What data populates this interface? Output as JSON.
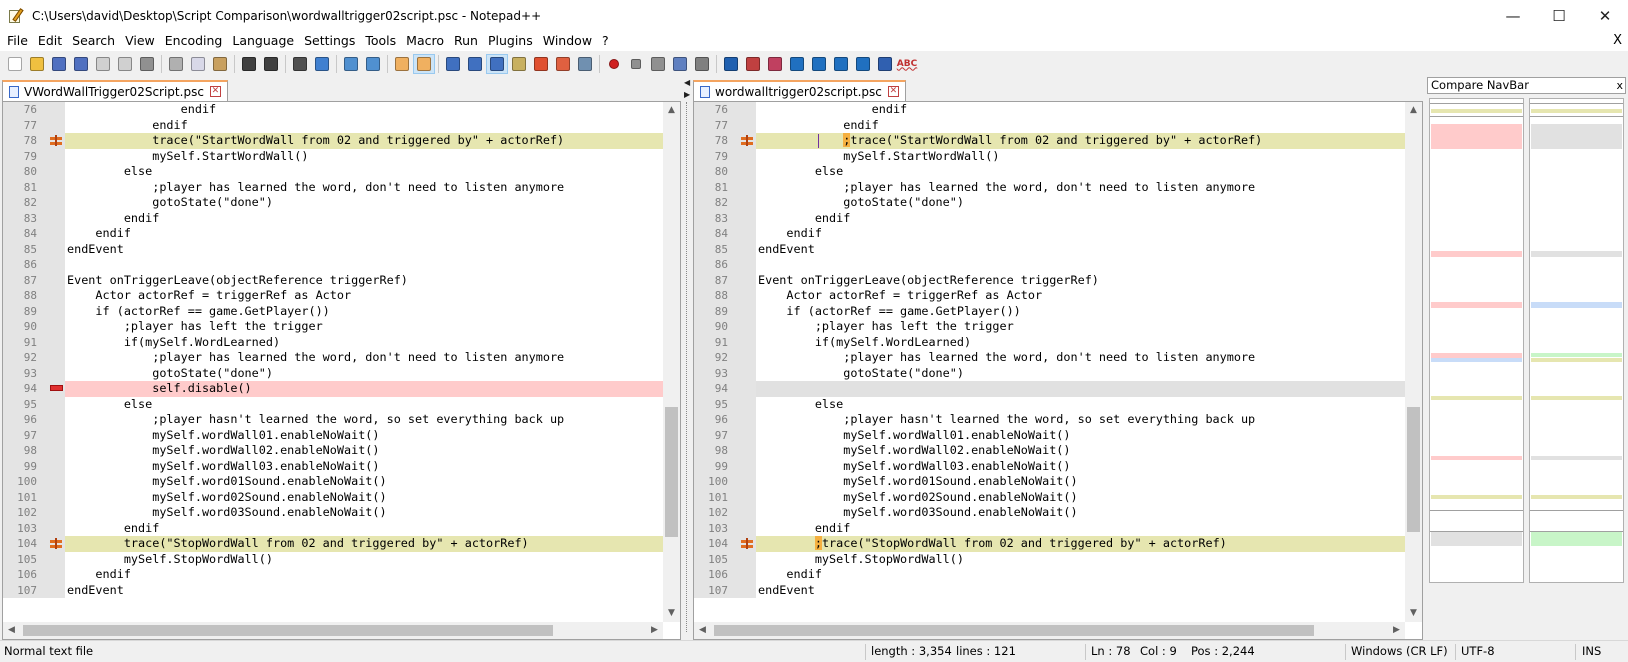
{
  "window": {
    "title": "C:\\Users\\david\\Desktop\\Script Comparison\\wordwalltrigger02script.psc - Notepad++",
    "minimize": "—",
    "maximize": "☐",
    "close": "✕"
  },
  "menu": {
    "items": [
      "File",
      "Edit",
      "Search",
      "View",
      "Encoding",
      "Language",
      "Settings",
      "Tools",
      "Macro",
      "Run",
      "Plugins",
      "Window",
      "?"
    ],
    "close_doc": "X"
  },
  "toolbar": {
    "icons": [
      "new-file-icon",
      "open-file-icon",
      "save-icon",
      "save-all-icon",
      "close-icon",
      "close-all-icon",
      "print-icon",
      "|",
      "cut-icon",
      "copy-icon",
      "paste-icon",
      "|",
      "undo-icon",
      "redo-icon",
      "|",
      "find-icon",
      "replace-icon",
      "|",
      "zoom-in-icon",
      "zoom-out-icon",
      "|",
      "sync-vertical-icon",
      "sync-horizontal-icon",
      "|",
      "word-wrap-icon",
      "show-all-chars-icon",
      "indent-guide-icon",
      "doc-map-icon",
      "function-list-icon",
      "folder-workspace-icon",
      "monitor-icon",
      "|",
      "record-macro-icon",
      "stop-macro-icon",
      "play-macro-icon",
      "run-macro-multiple-icon",
      "save-macro-icon",
      "|",
      "compare-icon",
      "clear-compare-icon",
      "navigation-icon",
      "first-diff-icon",
      "prev-diff-icon",
      "next-diff-icon",
      "last-diff-icon",
      "compare-panel-icon",
      "spellcheck-icon"
    ],
    "spellcheck_label": "ABC"
  },
  "left_pane": {
    "tab_label": "VWordWallTrigger02Script.psc",
    "lines": [
      {
        "n": "76",
        "text": "                endif",
        "state": "normal"
      },
      {
        "n": "77",
        "text": "            endif",
        "state": "normal"
      },
      {
        "n": "78",
        "text": "            trace(\"StartWordWall from 02 and triggered by\" + actorRef)",
        "state": "changed"
      },
      {
        "n": "79",
        "text": "            mySelf.StartWordWall()",
        "state": "normal"
      },
      {
        "n": "80",
        "text": "        else",
        "state": "normal"
      },
      {
        "n": "81",
        "text": "            ;player has learned the word, don't need to listen anymore",
        "state": "normal"
      },
      {
        "n": "82",
        "text": "            gotoState(\"done\")",
        "state": "normal"
      },
      {
        "n": "83",
        "text": "        endif",
        "state": "normal"
      },
      {
        "n": "84",
        "text": "    endif",
        "state": "normal"
      },
      {
        "n": "85",
        "text": "endEvent",
        "state": "normal"
      },
      {
        "n": "86",
        "text": "",
        "state": "normal"
      },
      {
        "n": "87",
        "text": "Event onTriggerLeave(objectReference triggerRef)",
        "state": "normal"
      },
      {
        "n": "88",
        "text": "    Actor actorRef = triggerRef as Actor",
        "state": "normal"
      },
      {
        "n": "89",
        "text": "    if (actorRef == game.GetPlayer())",
        "state": "normal"
      },
      {
        "n": "90",
        "text": "        ;player has left the trigger",
        "state": "normal"
      },
      {
        "n": "91",
        "text": "        if(mySelf.WordLearned)",
        "state": "normal"
      },
      {
        "n": "92",
        "text": "            ;player has learned the word, don't need to listen anymore",
        "state": "normal"
      },
      {
        "n": "93",
        "text": "            gotoState(\"done\")",
        "state": "normal"
      },
      {
        "n": "94",
        "text": "            self.disable()",
        "state": "removed"
      },
      {
        "n": "95",
        "text": "        else",
        "state": "normal"
      },
      {
        "n": "96",
        "text": "            ;player hasn't learned the word, so set everything back up",
        "state": "normal"
      },
      {
        "n": "97",
        "text": "            mySelf.wordWall01.enableNoWait()",
        "state": "normal"
      },
      {
        "n": "98",
        "text": "            mySelf.wordWall02.enableNoWait()",
        "state": "normal"
      },
      {
        "n": "99",
        "text": "            mySelf.wordWall03.enableNoWait()",
        "state": "normal"
      },
      {
        "n": "100",
        "text": "            mySelf.word01Sound.enableNoWait()",
        "state": "normal"
      },
      {
        "n": "101",
        "text": "            mySelf.word02Sound.enableNoWait()",
        "state": "normal"
      },
      {
        "n": "102",
        "text": "            mySelf.word03Sound.enableNoWait()",
        "state": "normal"
      },
      {
        "n": "103",
        "text": "        endif",
        "state": "normal"
      },
      {
        "n": "104",
        "text": "        trace(\"StopWordWall from 02 and triggered by\" + actorRef)",
        "state": "changed"
      },
      {
        "n": "105",
        "text": "        mySelf.StopWordWall()",
        "state": "normal"
      },
      {
        "n": "106",
        "text": "    endif",
        "state": "normal"
      },
      {
        "n": "107",
        "text": "endEvent",
        "state": "normal"
      }
    ]
  },
  "right_pane": {
    "tab_label": "wordwalltrigger02script.psc",
    "lines": [
      {
        "n": "76",
        "text": "                endif",
        "state": "normal"
      },
      {
        "n": "77",
        "text": "            endif",
        "state": "normal"
      },
      {
        "n": "78",
        "pre": "            ",
        "hl": ";",
        "text": "trace(\"StartWordWall from 02 and triggered by\" + actorRef)",
        "state": "changed"
      },
      {
        "n": "79",
        "text": "            mySelf.StartWordWall()",
        "state": "normal"
      },
      {
        "n": "80",
        "text": "        else",
        "state": "normal"
      },
      {
        "n": "81",
        "text": "            ;player has learned the word, don't need to listen anymore",
        "state": "normal"
      },
      {
        "n": "82",
        "text": "            gotoState(\"done\")",
        "state": "normal"
      },
      {
        "n": "83",
        "text": "        endif",
        "state": "normal"
      },
      {
        "n": "84",
        "text": "    endif",
        "state": "normal"
      },
      {
        "n": "85",
        "text": "endEvent",
        "state": "normal"
      },
      {
        "n": "86",
        "text": "",
        "state": "normal"
      },
      {
        "n": "87",
        "text": "Event onTriggerLeave(objectReference triggerRef)",
        "state": "normal"
      },
      {
        "n": "88",
        "text": "    Actor actorRef = triggerRef as Actor",
        "state": "normal"
      },
      {
        "n": "89",
        "text": "    if (actorRef == game.GetPlayer())",
        "state": "normal"
      },
      {
        "n": "90",
        "text": "        ;player has left the trigger",
        "state": "normal"
      },
      {
        "n": "91",
        "text": "        if(mySelf.WordLearned)",
        "state": "normal"
      },
      {
        "n": "92",
        "text": "            ;player has learned the word, don't need to listen anymore",
        "state": "normal"
      },
      {
        "n": "93",
        "text": "            gotoState(\"done\")",
        "state": "normal"
      },
      {
        "n": "94",
        "text": "",
        "state": "blank"
      },
      {
        "n": "95",
        "text": "        else",
        "state": "normal"
      },
      {
        "n": "96",
        "text": "            ;player hasn't learned the word, so set everything back up",
        "state": "normal"
      },
      {
        "n": "97",
        "text": "            mySelf.wordWall01.enableNoWait()",
        "state": "normal"
      },
      {
        "n": "98",
        "text": "            mySelf.wordWall02.enableNoWait()",
        "state": "normal"
      },
      {
        "n": "99",
        "text": "            mySelf.wordWall03.enableNoWait()",
        "state": "normal"
      },
      {
        "n": "100",
        "text": "            mySelf.word01Sound.enableNoWait()",
        "state": "normal"
      },
      {
        "n": "101",
        "text": "            mySelf.word02Sound.enableNoWait()",
        "state": "normal"
      },
      {
        "n": "102",
        "text": "            mySelf.word03Sound.enableNoWait()",
        "state": "normal"
      },
      {
        "n": "103",
        "text": "        endif",
        "state": "normal"
      },
      {
        "n": "104",
        "pre": "        ",
        "hl": ";",
        "text": "trace(\"StopWordWall from 02 and triggered by\" + actorRef)",
        "state": "changed"
      },
      {
        "n": "105",
        "text": "        mySelf.StopWordWall()",
        "state": "normal"
      },
      {
        "n": "106",
        "text": "    endif",
        "state": "normal"
      },
      {
        "n": "107",
        "text": "endEvent",
        "state": "normal"
      }
    ]
  },
  "compare_navbar": {
    "title": "Compare NavBar",
    "close": "x"
  },
  "status": {
    "file_type": "Normal text file",
    "length": "length : 3,354",
    "lines": "lines : 121",
    "ln": "Ln : 78",
    "col": "Col : 9",
    "pos": "Pos : 2,244",
    "eol": "Windows (CR LF)",
    "encoding": "UTF-8",
    "mode": "INS"
  },
  "colors": {
    "changed": "#e6e6b0",
    "removed": "#ffcbcb",
    "blank": "#e1e1e1",
    "moved_blue": "#c8dcf8",
    "added_green": "#c8f5c8",
    "tab_accent": "#f4a460"
  }
}
